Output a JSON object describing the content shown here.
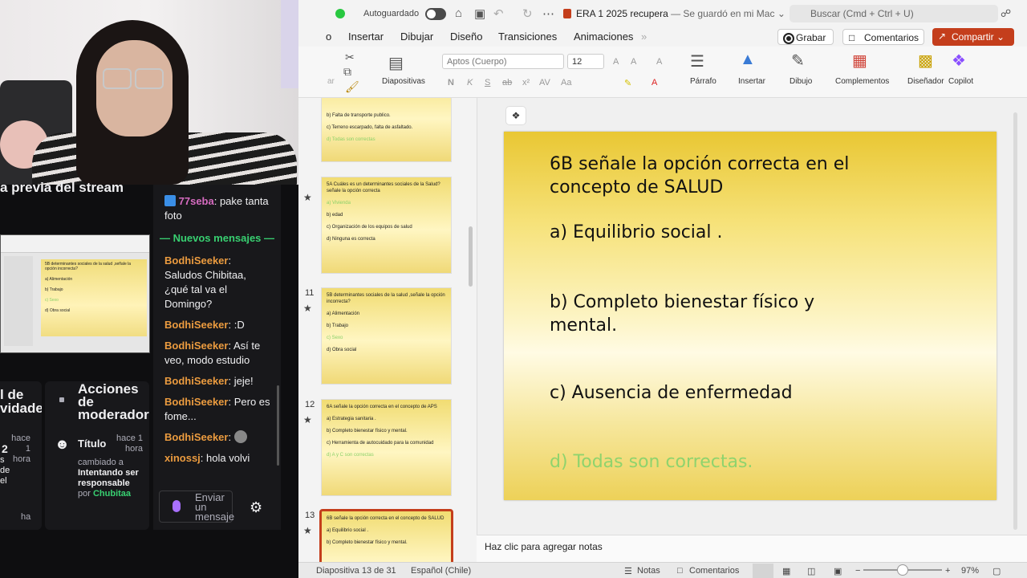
{
  "stream": {
    "preview_title": "a previa del stream",
    "preview_slide_lines": [
      "5B determinantes sociales de la salud ,señale la opción incorrecta?",
      "a) Alimentación",
      "b) Trabajo",
      "c) Sexo",
      "d) Obra social"
    ],
    "mod_left": {
      "title_line1": "l de",
      "title_line2": "vidades",
      "time_hace": "hace",
      "time_2": "2",
      "time_1": "1",
      "time_hora": "hora",
      "frag_s": "s",
      "frag_de": "de",
      "frag_el": "el",
      "frag_ha": "ha"
    },
    "mod_actions": {
      "title": "Acciones de moderador",
      "item_title": "Título",
      "item_time": "hace 1 hora",
      "item_desc_prefix": "cambiado a",
      "item_desc_value": "Intentando ser responsable",
      "item_by": "por",
      "item_user": "Chubitaa"
    }
  },
  "chat": {
    "top_message": {
      "user": "77seba",
      "text": ": pake tanta foto"
    },
    "new_messages_label": "— Nuevos mensajes —",
    "messages": [
      {
        "user": "BodhiSeeker",
        "text": ": Saludos Chibitaa, ¿qué tal va el Domingo?"
      },
      {
        "user": "BodhiSeeker",
        "text": ": :D"
      },
      {
        "user": "BodhiSeeker",
        "text": ": Así te veo, modo estudio"
      },
      {
        "user": "BodhiSeeker",
        "text": ": jeje!"
      },
      {
        "user": "BodhiSeeker",
        "text": ": Pero es fome..."
      },
      {
        "user": "BodhiSeeker",
        "text": ":"
      },
      {
        "user": "xinossj",
        "text": ": hola volvi"
      }
    ],
    "input_placeholder": "Enviar un mensaje"
  },
  "ppt": {
    "autosave_label": "Autoguardado",
    "doc_name": "ERA 1 2025 recupera",
    "doc_status": " — Se guardó en mi Mac",
    "search_placeholder": "Buscar (Cmd + Ctrl + U)",
    "tabs": [
      "o",
      "Insertar",
      "Dibujar",
      "Diseño",
      "Transiciones",
      "Animaciones"
    ],
    "grabar": "Grabar",
    "comentarios": "Comentarios",
    "compartir": "Compartir",
    "ribbon": {
      "diapositivas": "Diapositivas",
      "font_name": "Aptos (Cuerpo)",
      "font_size": "12",
      "parrafo": "Párrafo",
      "insertar": "Insertar",
      "dibujo": "Dibujo",
      "complementos": "Complementos",
      "disenador": "Diseñador",
      "copilot": "Copilot",
      "pegar_frag": "ar"
    },
    "thumbnails": [
      {
        "num": "",
        "lines": [
          "b) Falta de transporte publico.",
          "c) Terreno escarpado, falta de asfaltado.",
          "d) Todas son correctas"
        ],
        "green_index": 2
      },
      {
        "num": "",
        "lines": [
          "5A Cuáles es un determinantes sociales de la Salud? señale la opción correcta",
          "a) Vivienda",
          "b) edad",
          "c) Organización de los equipos de salud",
          "d) Ninguna es correcta"
        ],
        "green_index": 1
      },
      {
        "num": "11",
        "lines": [
          "5B determinantes sociales de la salud ,señale la opción incorrecta?",
          "a) Alimentación",
          "b) Trabajo",
          "c) Sexo",
          "d) Obra social"
        ],
        "green_index": 3
      },
      {
        "num": "12",
        "lines": [
          "6A señale la opción correcta en el concepto de APS",
          "a) Estrategia sanitaria .",
          "b) Completo bienestar físico y mental.",
          "c) Herramienta de autocuidado para la comunidad",
          "d) A y C son correctas"
        ],
        "green_index": 4
      },
      {
        "num": "13",
        "lines": [
          "6B señale la opción correcta en el concepto de SALUD",
          "a) Equilibrio social .",
          "b) Completo bienestar físico y mental."
        ],
        "green_index": -1
      }
    ],
    "slide": {
      "title": "6B   señale la opción correcta en el concepto de SALUD",
      "options": [
        "a) Equilibrio social  .",
        "b) Completo bienestar físico y mental.",
        "c) Ausencia de enfermedad",
        "d)  Todas son correctas."
      ],
      "correct_color": "#8fd36d"
    },
    "notes_placeholder": "Haz clic para agregar notas",
    "status": {
      "slide_info": "Diapositiva 13 de 31",
      "language": "Español (Chile)",
      "notas": "Notas",
      "comentarios": "Comentarios",
      "zoom": "97%"
    }
  }
}
